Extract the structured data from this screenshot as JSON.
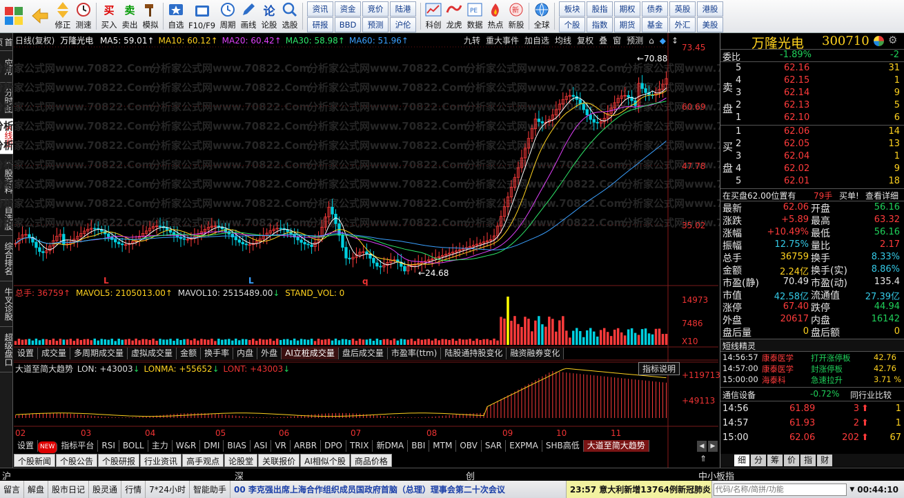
{
  "toolbar": {
    "buttons": [
      {
        "name": "buy-button",
        "label": "买入",
        "icon": "buy-icon"
      },
      {
        "name": "sell-button",
        "label": "卖出",
        "icon": "sell-icon"
      },
      {
        "name": "simulate-button",
        "label": "模拟",
        "icon": "hammer-icon"
      }
    ],
    "nav_buttons": [
      {
        "label": "修正"
      },
      {
        "label": "测速"
      }
    ],
    "tools": [
      {
        "name": "favorites-button",
        "label": "自选",
        "icon": "star-icon"
      },
      {
        "name": "f10-button",
        "label": "F10/F9",
        "icon": "f10-icon"
      },
      {
        "name": "period-button",
        "label": "周期",
        "icon": "clock-icon"
      },
      {
        "name": "draw-button",
        "label": "画线",
        "icon": "pen-icon"
      },
      {
        "name": "forum-button",
        "label": "论股",
        "icon": "forum-icon"
      },
      {
        "name": "select-stock-button",
        "label": "选股",
        "icon": "magnifier-icon"
      }
    ],
    "grid_a": [
      "资讯",
      "研报",
      "资金",
      "BBD",
      "竞价",
      "预测",
      "陆港",
      "沪伦"
    ],
    "tools2": [
      {
        "name": "kechuang-button",
        "label": "科创",
        "icon": "chart-icon"
      },
      {
        "name": "longhu-button",
        "label": "龙虎",
        "icon": "dragon-icon"
      },
      {
        "name": "data-button",
        "label": "数据",
        "icon": "pe-icon"
      },
      {
        "name": "hot-button",
        "label": "热点",
        "icon": "fire-icon"
      },
      {
        "name": "new-stock-button",
        "label": "新股",
        "icon": "new-stock-icon"
      },
      {
        "name": "global-button",
        "label": "全球",
        "icon": "globe-icon"
      }
    ],
    "grid_b": [
      "板块",
      "个股",
      "股指",
      "指数",
      "期权",
      "期货",
      "债券",
      "基金",
      "英股",
      "外汇",
      "港股",
      "美股"
    ]
  },
  "left_tabs": [
    {
      "label": "首页"
    },
    {
      "label": "应用"
    },
    {
      "label": "分时图"
    },
    {
      "label": "K线图",
      "active": true
    },
    {
      "label": "个股资料"
    },
    {
      "label": "自选股"
    },
    {
      "label": "综合排名"
    },
    {
      "label": "牛叉诊股"
    },
    {
      "label": "超级盘口"
    }
  ],
  "chart": {
    "title": "日线(复权)",
    "stock_name": "万隆光电",
    "ma": [
      {
        "label": "MA5: 59.01",
        "color": "#ffffff"
      },
      {
        "label": "MA10: 60.12",
        "color": "#ffd21f"
      },
      {
        "label": "MA20: 60.42",
        "color": "#e040fb"
      },
      {
        "label": "MA30: 58.98",
        "color": "#2ee86a"
      },
      {
        "label": "MA60: 51.96",
        "color": "#3aa0ff"
      }
    ],
    "top_buttons": [
      "九转",
      "重大事件",
      "加自选",
      "均线",
      "复权",
      "叠",
      "窗",
      "预测"
    ],
    "y_labels": [
      "73.45",
      "60.69",
      "47.78",
      "35.02"
    ],
    "high_label": "70.88",
    "low_label": "24.68",
    "markers": [
      "L",
      "L",
      "q"
    ],
    "vol_header": {
      "total": "总手: 36759",
      "mavol5": "MAVOL5: 2105013.00",
      "mavol10": "MAVOL10: 2515489.00",
      "stand": "STAND_VOL: 0"
    },
    "vol_y_labels": [
      "14973",
      "7486",
      "X10"
    ],
    "indicator_tabs": [
      "设置",
      "成交量",
      "多周期成交量",
      "虚拟成交量",
      "金额",
      "换手率",
      "内盘",
      "外盘",
      "AI立桩成交量",
      "盘后成交量",
      "市盈率(ttm)",
      "陆股通持股变化",
      "融资融券变化"
    ],
    "lon_header": {
      "name": "大道至简大趋势",
      "lon": "LON: +43003",
      "lonma": "LONMA: +55652",
      "lont": "LONT: +43003"
    },
    "lon_button": "指标说明",
    "lon_y_labels": [
      "+119713",
      "+49113"
    ],
    "months": [
      "02",
      "03",
      "04",
      "05",
      "06",
      "07",
      "08",
      "09",
      "10",
      "11"
    ],
    "bottom_tabs": [
      "设置",
      "NEW",
      "指标平台",
      "RSI",
      "BOLL",
      "主力",
      "W&R",
      "DMI",
      "BIAS",
      "ASI",
      "VR",
      "ARBR",
      "DPO",
      "TRIX",
      "新DMA",
      "BBI",
      "MTM",
      "OBV",
      "SAR",
      "EXPMA",
      "SHB高低",
      "大道至简大趋势"
    ],
    "news_tabs": [
      "个股新闻",
      "个股公告",
      "个股研报",
      "行业资讯",
      "高手观点",
      "论股堂",
      "关联报价",
      "AI相似个股",
      "商品价格"
    ],
    "watermark": "分析家公式网www.70822.Com"
  },
  "right": {
    "name": "万隆光电",
    "code": "300710",
    "weibi_label": "委比",
    "weibi": "-1.89%",
    "weicha": "-2",
    "sell_label": "卖盘",
    "buy_label": "买盘",
    "asks": [
      {
        "lvl": "5",
        "price": "62.16",
        "vol": "31"
      },
      {
        "lvl": "4",
        "price": "62.15",
        "vol": "1"
      },
      {
        "lvl": "3",
        "price": "62.14",
        "vol": "9"
      },
      {
        "lvl": "2",
        "price": "62.13",
        "vol": "5"
      },
      {
        "lvl": "1",
        "price": "62.10",
        "vol": "6"
      }
    ],
    "bids": [
      {
        "lvl": "1",
        "price": "62.06",
        "vol": "14"
      },
      {
        "lvl": "2",
        "price": "62.05",
        "vol": "13"
      },
      {
        "lvl": "3",
        "price": "62.04",
        "vol": "1"
      },
      {
        "lvl": "4",
        "price": "62.02",
        "vol": "9"
      },
      {
        "lvl": "5",
        "price": "62.01",
        "vol": "18"
      }
    ],
    "order_info": "在买盘62.00位置有",
    "order_qty": "79手",
    "order_side": "买单!",
    "order_detail": "查看详细",
    "stats_left": [
      {
        "k": "最新",
        "v": "62.06",
        "c": "red"
      },
      {
        "k": "涨跌",
        "v": "+5.89",
        "c": "red"
      },
      {
        "k": "涨幅",
        "v": "+10.49%",
        "c": "red"
      },
      {
        "k": "振幅",
        "v": "12.75%",
        "c": "cyan"
      },
      {
        "k": "总手",
        "v": "36759",
        "c": "yel"
      },
      {
        "k": "金额",
        "v": "2.24亿",
        "c": "yel"
      },
      {
        "k": "市盈(静)",
        "v": "70.49",
        "c": "wht"
      },
      {
        "k": "市值",
        "v": "42.58亿",
        "c": "cyan"
      },
      {
        "k": "涨停",
        "v": "67.40",
        "c": "red"
      },
      {
        "k": "外盘",
        "v": "20617",
        "c": "red"
      },
      {
        "k": "盘后量",
        "v": "0",
        "c": "yel"
      }
    ],
    "stats_right": [
      {
        "k": "开盘",
        "v": "56.16",
        "c": "grn"
      },
      {
        "k": "最高",
        "v": "63.32",
        "c": "red"
      },
      {
        "k": "最低",
        "v": "56.16",
        "c": "grn"
      },
      {
        "k": "量比",
        "v": "2.17",
        "c": "red"
      },
      {
        "k": "换手",
        "v": "8.33%",
        "c": "cyan"
      },
      {
        "k": "换手(实)",
        "v": "8.86%",
        "c": "cyan"
      },
      {
        "k": "市盈(动)",
        "v": "135.4",
        "c": "wht"
      },
      {
        "k": "流通值",
        "v": "27.39亿",
        "c": "cyan"
      },
      {
        "k": "跌停",
        "v": "44.94",
        "c": "grn"
      },
      {
        "k": "内盘",
        "v": "16142",
        "c": "grn"
      },
      {
        "k": "盘后额",
        "v": "0",
        "c": "yel"
      }
    ],
    "short_title": "短线精灵",
    "short_rows": [
      {
        "t": "14:56:57",
        "name": "康泰医学",
        "ev": "打开涨停板",
        "v": "42.76"
      },
      {
        "t": "14:57:00",
        "name": "康泰医学",
        "ev": "封涨停板",
        "v": "42.76"
      },
      {
        "t": "15:00:00",
        "name": "海泰科",
        "ev": "急速拉升",
        "v": "3.71 %"
      }
    ],
    "industry": "通信设备",
    "industry_chg": "-0.72%",
    "industry_btn": "同行业比较",
    "ticks": [
      {
        "t": "14:56",
        "p": "61.89",
        "v": "3",
        "d": "1"
      },
      {
        "t": "14:57",
        "p": "61.93",
        "v": "2",
        "d": "1"
      },
      {
        "t": "15:00",
        "p": "62.06",
        "v": "202",
        "d": "67"
      }
    ],
    "bottom_tabs": [
      "细",
      "分",
      "筹",
      "价",
      "指",
      "财"
    ]
  },
  "ticker": {
    "sh": "沪",
    "sz": "深",
    "cy": "创",
    "zx": "中小板指"
  },
  "status": {
    "items": [
      "留言",
      "解盘",
      "股市日记",
      "股灵通",
      "行情",
      "7*24小时",
      "智能助手"
    ],
    "news1": "00 李克强出席上海合作组织成员国政府首脑（总理）理事会第二十次会议",
    "news2": "23:57 意大利新增13764例新冠肺炎",
    "search_placeholder": "代码/名称/简拼/功能",
    "clock": "00:44:10"
  }
}
